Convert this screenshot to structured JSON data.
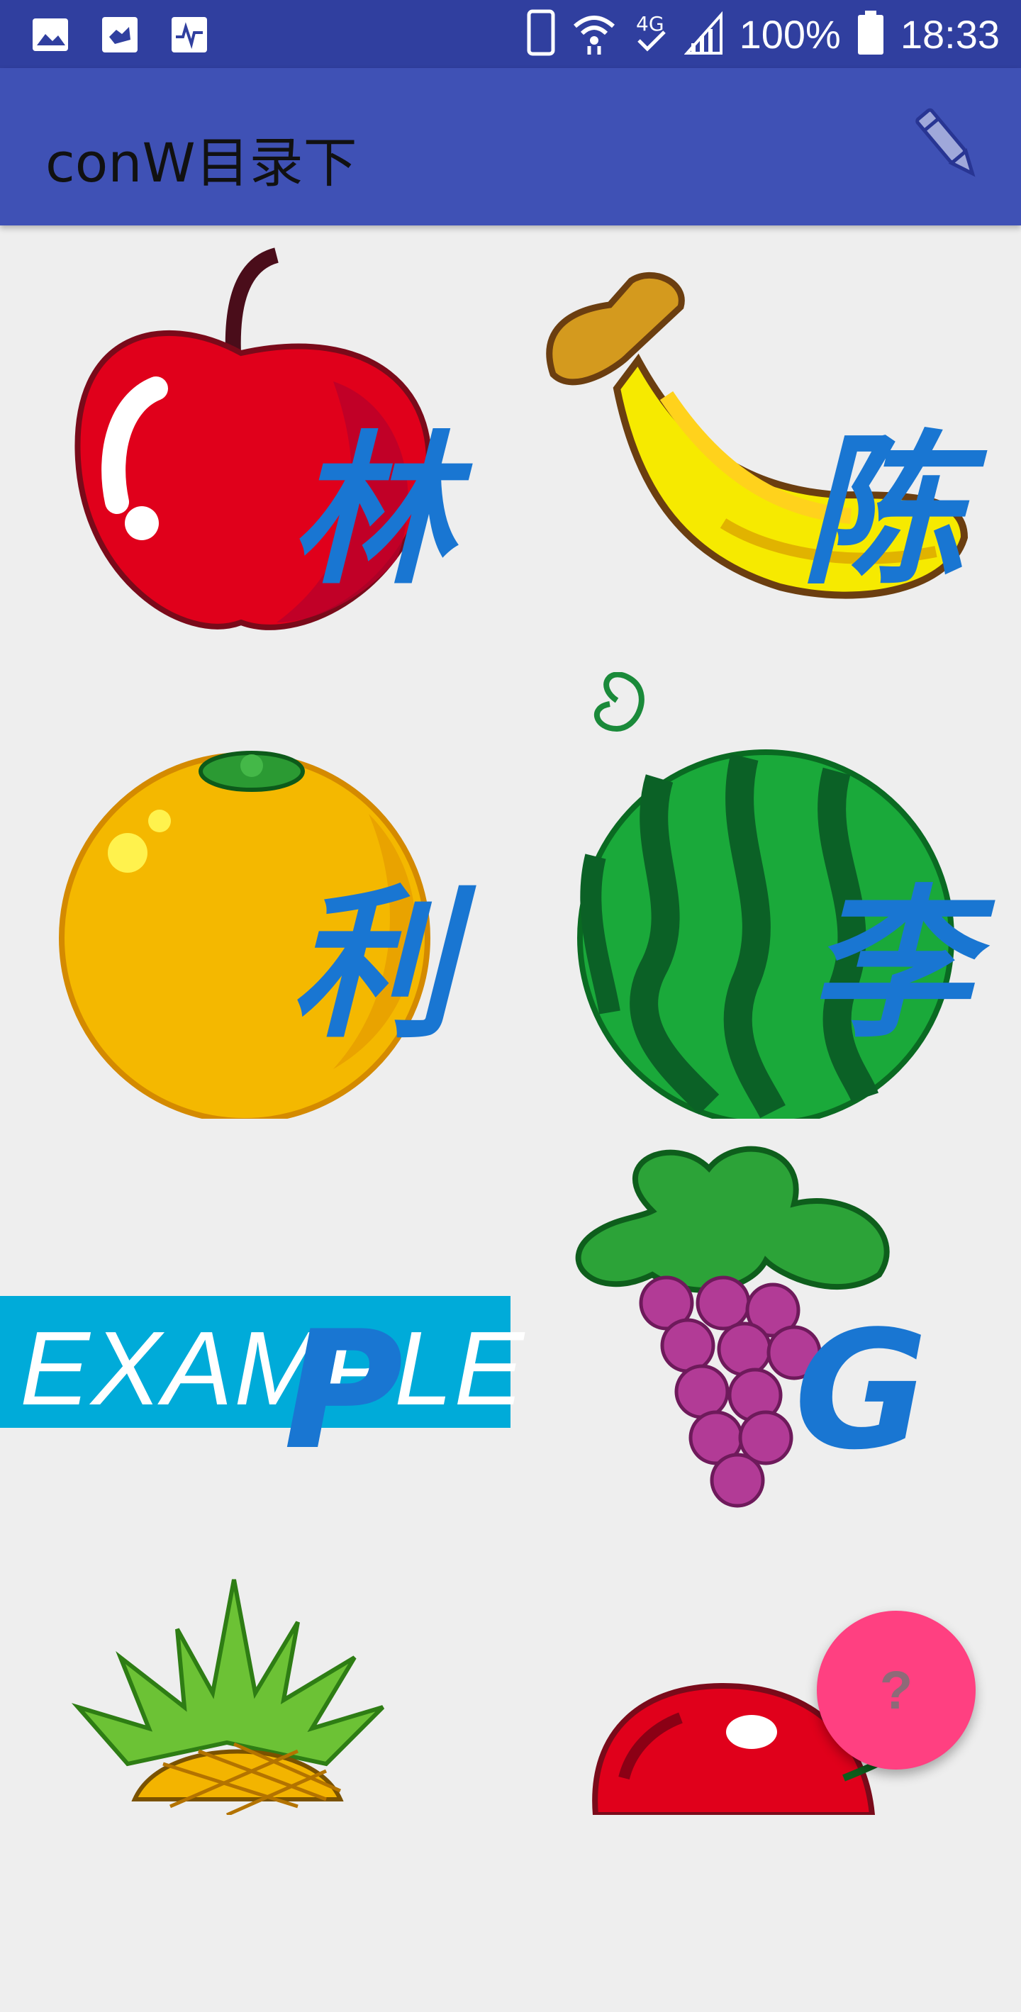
{
  "status_bar": {
    "icons_left": [
      "image-icon",
      "hand-icon",
      "activity-icon"
    ],
    "icons_right": [
      "phone-icon",
      "wifi-icon",
      "4g-icon",
      "signal-icon"
    ],
    "battery_text": "100%",
    "time": "18:33"
  },
  "app_bar": {
    "title": "conW目录下",
    "action_icon": "edit-icon"
  },
  "grid": {
    "items": [
      {
        "image": "apple-icon",
        "caption": "林"
      },
      {
        "image": "banana-icon",
        "caption": "陈"
      },
      {
        "image": "orange-icon",
        "caption": "利"
      },
      {
        "image": "watermelon-icon",
        "caption": "李"
      },
      {
        "image": "example-banner",
        "banner_text": "EXAMPLE",
        "caption": "P"
      },
      {
        "image": "grapes-icon",
        "caption": "G"
      },
      {
        "image": "pineapple-icon",
        "caption": ""
      },
      {
        "image": "cherry-icon",
        "caption": ""
      }
    ]
  },
  "fab": {
    "label": "?",
    "color": "#ff4081"
  },
  "colors": {
    "status_bar": "#303f9f",
    "app_bar": "#3f51b5",
    "caption": "#1976d2",
    "background": "#eeeeee"
  }
}
